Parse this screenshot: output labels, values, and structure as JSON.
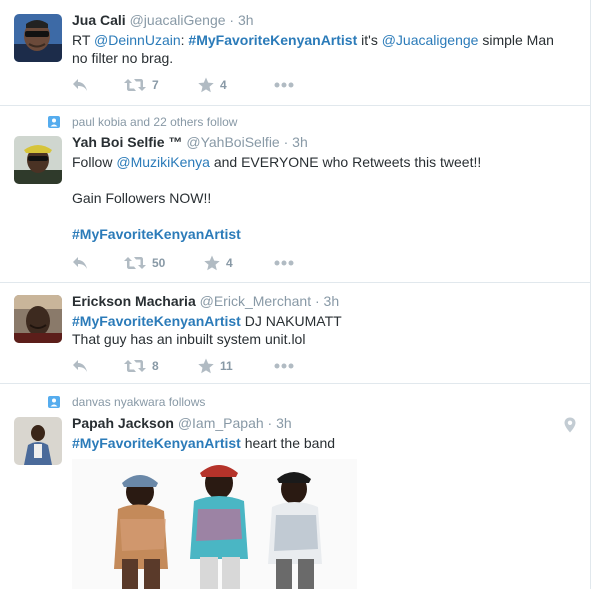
{
  "tweets": [
    {
      "name": "Jua Cali",
      "handle": "@juacaliGenge",
      "time": "3h",
      "text": {
        "p1": "RT ",
        "mention1": "@DeinnUzain",
        "p2": ": ",
        "hashtag": "#MyFavoriteKenyanArtist",
        "p3": " it's ",
        "mention2": "@Juacaligenge",
        "p4": " simple Man",
        "line2": "no filter no brag."
      },
      "retweets": "7",
      "favorites": "4"
    },
    {
      "context": "paul kobia and 22 others follow",
      "name": "Yah Boi Selfie ™",
      "handle": "@YahBoiSelfie",
      "time": "3h",
      "text": {
        "p1": "Follow ",
        "mention": "@MuzikiKenya",
        "p2": " and EVERYONE who Retweets this tweet!!",
        "line2": "Gain Followers NOW!!",
        "hashtag": "#MyFavoriteKenyanArtist"
      },
      "retweets": "50",
      "favorites": "4"
    },
    {
      "name": "Erickson Macharia",
      "handle": "@Erick_Merchant",
      "time": "3h",
      "text": {
        "hashtag": "#MyFavoriteKenyanArtist",
        "p1": " DJ NAKUMATT",
        "line2": "That guy has an inbuilt system unit.lol"
      },
      "retweets": "8",
      "favorites": "11"
    },
    {
      "context": "danvas nyakwara follows",
      "name": "Papah Jackson",
      "handle": "@Iam_Papah",
      "time": "3h",
      "text": {
        "hashtag": "#MyFavoriteKenyanArtist",
        "p1": " heart the band"
      }
    }
  ],
  "separator": " · ",
  "icons": {
    "reply": "reply-icon",
    "retweet": "retweet-icon",
    "favorite": "star-icon",
    "more": "more-icon",
    "follow_context": "person-icon",
    "location": "location-pin-icon"
  },
  "colors": {
    "link": "#2b7bb9",
    "muted": "#8899a6",
    "text": "#292f33",
    "border": "#e1e8ed"
  }
}
